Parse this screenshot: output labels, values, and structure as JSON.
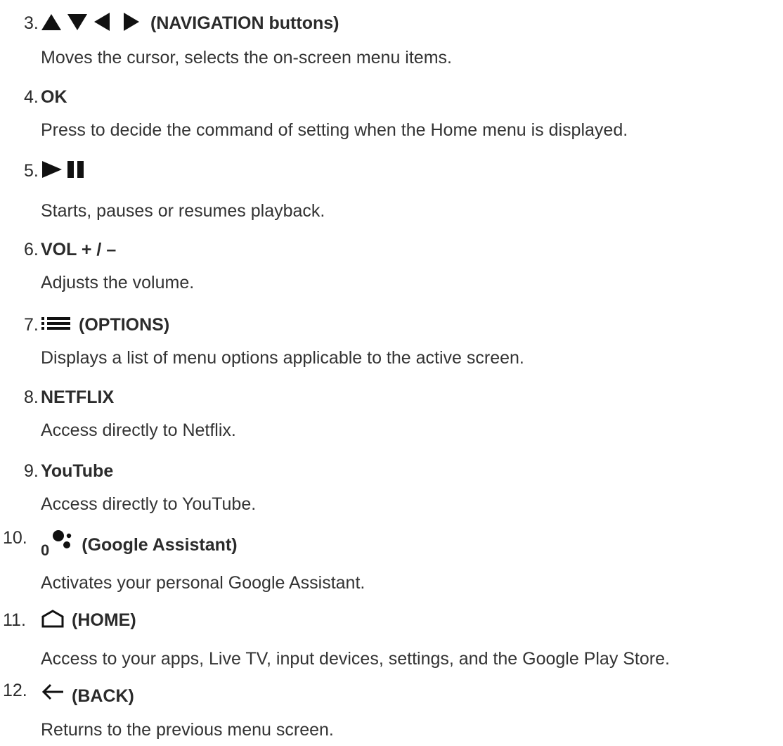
{
  "items": [
    {
      "number": "3.",
      "label": "(NAVIGATION buttons)",
      "icon": "navigation-arrows-icon",
      "description": "Moves the cursor, selects the on-screen menu items."
    },
    {
      "number": "4.",
      "label": "OK",
      "icon": "",
      "description": "Press to decide the command of setting when the Home menu is displayed."
    },
    {
      "number": "5.",
      "label": "",
      "icon": "play-pause-icon",
      "description": "Starts, pauses or resumes playback."
    },
    {
      "number": "6.",
      "label": "VOL + / –",
      "icon": "",
      "description": "Adjusts the volume."
    },
    {
      "number": "7.",
      "label": "(OPTIONS)",
      "icon": "options-list-icon",
      "description": "Displays a list of menu options applicable to the active screen."
    },
    {
      "number": "8.",
      "label": "NETFLIX",
      "icon": "",
      "description": "Access directly to Netflix."
    },
    {
      "number": "9.",
      "label": "YouTube",
      "icon": "",
      "description": "Access directly to YouTube."
    },
    {
      "number": "10.",
      "prefix": "0",
      "label": "(Google Assistant)",
      "icon": "google-assistant-icon",
      "description": "Activates your personal Google Assistant."
    },
    {
      "number": "11.",
      "label": "(HOME)",
      "icon": "home-icon",
      "description": "Access to your apps, Live TV, input devices, settings, and the Google Play Store."
    },
    {
      "number": "12.",
      "label": "(BACK)",
      "icon": "back-arrow-icon",
      "description": "Returns to the previous menu screen."
    }
  ]
}
